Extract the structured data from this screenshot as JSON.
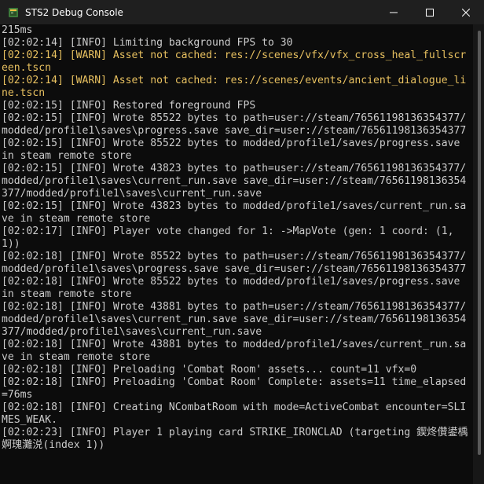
{
  "window": {
    "title": "STS2 Debug Console",
    "minimize_icon": "minimize-icon",
    "maximize_icon": "maximize-icon",
    "close_icon": "close-icon",
    "app_icon": "console-app-icon"
  },
  "colors": {
    "background": "#0c0c0c",
    "text": "#cccccc",
    "warn": "#e8c160"
  },
  "log": [
    {
      "level": "info",
      "text": "215ms"
    },
    {
      "level": "info",
      "text": "[02:02:14] [INFO] Limiting background FPS to 30"
    },
    {
      "level": "warn",
      "text": "[02:02:14] [WARN] Asset not cached: res://scenes/vfx/vfx_cross_heal_fullscreen.tscn"
    },
    {
      "level": "warn",
      "text": "[02:02:14] [WARN] Asset not cached: res://scenes/events/ancient_dialogue_line.tscn"
    },
    {
      "level": "info",
      "text": "[02:02:15] [INFO] Restored foreground FPS"
    },
    {
      "level": "info",
      "text": "[02:02:15] [INFO] Wrote 85522 bytes to path=user://steam/76561198136354377/modded/profile1\\saves\\progress.save save_dir=user://steam/76561198136354377"
    },
    {
      "level": "info",
      "text": "[02:02:15] [INFO] Wrote 85522 bytes to modded/profile1/saves/progress.save in steam remote store"
    },
    {
      "level": "info",
      "text": "[02:02:15] [INFO] Wrote 43823 bytes to path=user://steam/76561198136354377/modded/profile1\\saves\\current_run.save save_dir=user://steam/76561198136354377/modded/profile1\\saves\\current_run.save"
    },
    {
      "level": "info",
      "text": "[02:02:15] [INFO] Wrote 43823 bytes to modded/profile1/saves/current_run.save in steam remote store"
    },
    {
      "level": "info",
      "text": "[02:02:17] [INFO] Player vote changed for 1: ->MapVote (gen: 1 coord: (1, 1))"
    },
    {
      "level": "info",
      "text": "[02:02:18] [INFO] Wrote 85522 bytes to path=user://steam/76561198136354377/modded/profile1\\saves\\progress.save save_dir=user://steam/76561198136354377"
    },
    {
      "level": "info",
      "text": "[02:02:18] [INFO] Wrote 85522 bytes to modded/profile1/saves/progress.save in steam remote store"
    },
    {
      "level": "info",
      "text": "[02:02:18] [INFO] Wrote 43881 bytes to path=user://steam/76561198136354377/modded/profile1\\saves\\current_run.save save_dir=user://steam/76561198136354377/modded/profile1\\saves\\current_run.save"
    },
    {
      "level": "info",
      "text": "[02:02:18] [INFO] Wrote 43881 bytes to modded/profile1/saves/current_run.save in steam remote store"
    },
    {
      "level": "info",
      "text": "[02:02:18] [INFO] Preloading 'Combat Room' assets... count=11 vfx=0"
    },
    {
      "level": "info",
      "text": "[02:02:18] [INFO] Preloading 'Combat Room' Complete: assets=11 time_elapsed=76ms"
    },
    {
      "level": "info",
      "text": "[02:02:18] [INFO] Creating NCombatRoom with mode=ActiveCombat encounter=SLIMES_WEAK."
    },
    {
      "level": "info",
      "text": "[02:02:23] [INFO] Player 1 playing card STRIKE_IRONCLAD (targeting 鍥炵儹鍙楀婀瑰灘涚(index 1))"
    }
  ]
}
